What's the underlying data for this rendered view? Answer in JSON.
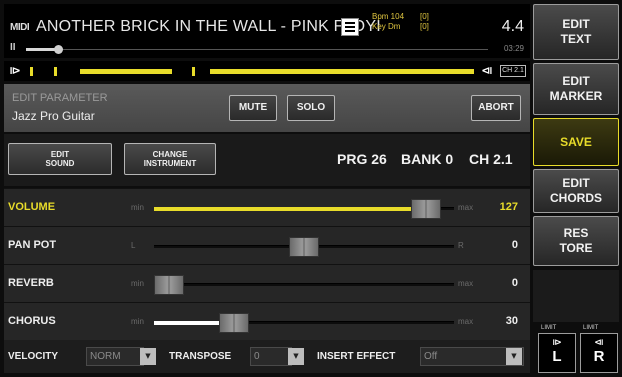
{
  "header": {
    "logo": "MIDI",
    "song_title": "ANOTHER BRICK IN THE WALL - PINK FLOYI",
    "bpm": "Bpm 104",
    "key": "Key Dm",
    "meta_a": "[0]",
    "meta_b": "[0]",
    "time_signature": "4.4",
    "time_position": "03:29",
    "pause_icon": "pause-icon",
    "progress": 0.07
  },
  "loopbar": {
    "channel_badge": "CH 2.1",
    "start_icon": "loop-start-icon",
    "end_icon": "loop-end-icon"
  },
  "edit": {
    "caption": "EDIT PARAMETER",
    "instrument": "Jazz Pro Guitar",
    "mute_label": "MUTE",
    "solo_label": "SOLO",
    "abort_label": "ABORT"
  },
  "sound": {
    "edit_sound_line1": "EDIT",
    "edit_sound_line2": "SOUND",
    "change_instr_line1": "CHANGE",
    "change_instr_line2": "INSTRUMENT",
    "prg": "PRG 26",
    "bank": "BANK 0",
    "channel": "CH 2.1"
  },
  "sliders": [
    {
      "label": "VOLUME",
      "min": "min",
      "max": "max",
      "value": "127",
      "level": 0.95,
      "active": true
    },
    {
      "label": "PAN POT",
      "min": "L",
      "max": "R",
      "value": "0",
      "level": 0.5,
      "active": false
    },
    {
      "label": "REVERB",
      "min": "min",
      "max": "max",
      "value": "0",
      "level": 0.0,
      "active": false
    },
    {
      "label": "CHORUS",
      "min": "min",
      "max": "max",
      "value": "30",
      "level": 0.24,
      "active": false
    }
  ],
  "options": {
    "velocity_label": "VELOCITY",
    "velocity_value": "NORM",
    "transpose_label": "TRANSPOSE",
    "transpose_value": "0",
    "insert_label": "INSERT EFFECT",
    "insert_value": "Off"
  },
  "sidebar": {
    "edit_text_1": "EDIT",
    "edit_text_2": "TEXT",
    "edit_marker_1": "EDIT",
    "edit_marker_2": "MARKER",
    "save": "SAVE",
    "edit_chords_1": "EDIT",
    "edit_chords_2": "CHORDS",
    "restore_1": "RES",
    "restore_2": "TORE",
    "limit_left_label": "LIMIT",
    "limit_right_label": "LIMIT",
    "limit_left_letter": "L",
    "limit_right_letter": "R"
  },
  "colors": {
    "accent_yellow": "#e8dc2a",
    "chorus_fill": "#ffffff"
  }
}
